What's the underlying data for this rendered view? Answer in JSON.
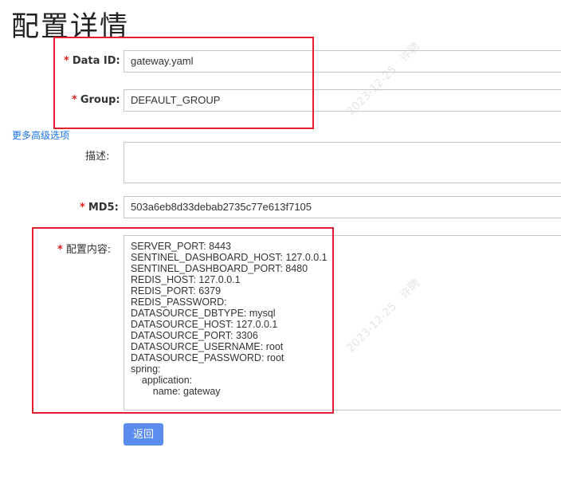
{
  "page": {
    "title": "配置详情"
  },
  "form": {
    "data_id": {
      "required_mark": "*",
      "label": "Data ID:",
      "value": "gateway.yaml"
    },
    "group": {
      "required_mark": "*",
      "label": "Group:",
      "value": "DEFAULT_GROUP"
    },
    "more_options_link": "更多高级选项",
    "description": {
      "label": "描述:",
      "value": ""
    },
    "md5": {
      "required_mark": "*",
      "label": "MD5:",
      "value": "503a6eb8d33debab2735c77e613f7105"
    },
    "content": {
      "required_mark": "*",
      "label": "配置内容:",
      "lines": [
        "SERVER_PORT: 8443",
        "SENTINEL_DASHBOARD_HOST: 127.0.0.1",
        "SENTINEL_DASHBOARD_PORT: 8480",
        "REDIS_HOST: 127.0.0.1",
        "REDIS_PORT: 6379",
        "REDIS_PASSWORD:",
        "DATASOURCE_DBTYPE: mysql",
        "DATASOURCE_HOST: 127.0.0.1",
        "DATASOURCE_PORT: 3306",
        "DATASOURCE_USERNAME: root",
        "DATASOURCE_PASSWORD: root",
        "spring:",
        "    application:",
        "        name: gateway"
      ]
    },
    "back_button": "返回"
  },
  "watermark": {
    "text_date": "2023-12-25",
    "text_name": "许聘"
  },
  "colors": {
    "highlight_box": "#e02030",
    "required_mark": "#e02020",
    "link": "#1a73e8",
    "primary_button": "#5b8def"
  }
}
